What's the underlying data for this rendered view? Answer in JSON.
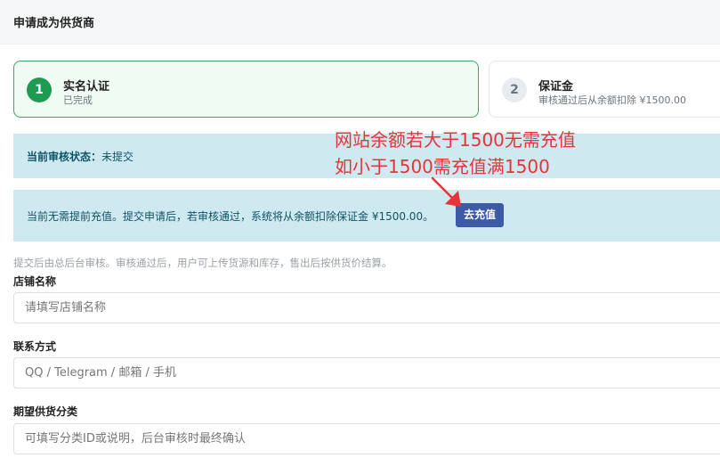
{
  "page": {
    "title": "申请成为供货商"
  },
  "steps": [
    {
      "number": "1",
      "title": "实名认证",
      "subtitle": "已完成"
    },
    {
      "number": "2",
      "title": "保证金",
      "subtitle": "审核通过后从余额扣除 ¥1500.00"
    }
  ],
  "status": {
    "label": "当前审核状态：",
    "value": "未提交"
  },
  "recharge_notice": {
    "text": "当前无需提前充值。提交申请后，若审核通过，系统将从余额扣除保证金 ¥1500.00。",
    "button_label": "去充值"
  },
  "note": "提交后由总后台审核。审核通过后，用户可上传货源和库存，售出后按供货价结算。",
  "form": {
    "store_name": {
      "label": "店铺名称",
      "placeholder": "请填写店铺名称"
    },
    "contact": {
      "label": "联系方式",
      "placeholder": "QQ / Telegram / 邮箱 / 手机"
    },
    "category": {
      "label": "期望供货分类",
      "placeholder": "可填写分类ID或说明，后台审核时最终确认"
    }
  },
  "annotation": {
    "line1": "网站余额若大于1500无需充值",
    "line2": "如小于1500需充值满1500",
    "color": "#e8333a"
  },
  "colors": {
    "success": "#1f9a52",
    "info_bg": "#cfe9f0",
    "info_text": "#0f5466",
    "primary_button": "#3d5aa6"
  }
}
